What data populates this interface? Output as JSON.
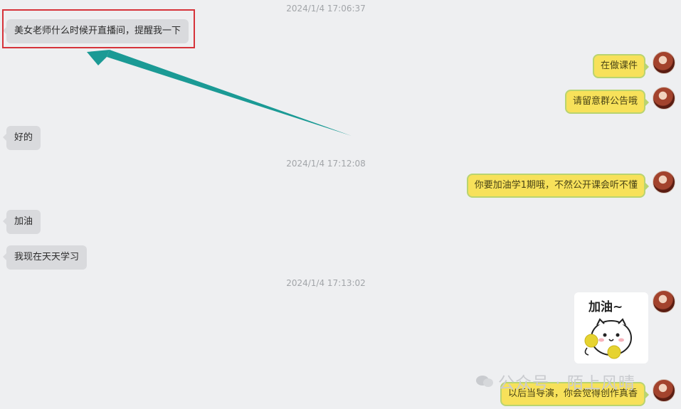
{
  "messages": [
    {
      "type": "timestamp",
      "text": "2024/1/4 17:06:37"
    },
    {
      "type": "left",
      "text": "美女老师什么时候开直播间，提醒我一下"
    },
    {
      "type": "right",
      "text": "在做课件"
    },
    {
      "type": "right",
      "text": "请留意群公告哦"
    },
    {
      "type": "left",
      "text": "好的"
    },
    {
      "type": "timestamp",
      "text": "2024/1/4 17:12:08"
    },
    {
      "type": "right",
      "text": "你要加油学1期哦，不然公开课会听不懂"
    },
    {
      "type": "left",
      "text": "加油"
    },
    {
      "type": "left",
      "text": "我现在天天学习"
    },
    {
      "type": "timestamp",
      "text": "2024/1/4 17:13:02"
    },
    {
      "type": "right",
      "text": "以后当导演，你会觉得创作真香"
    }
  ],
  "sticker": {
    "caption": "加油~"
  },
  "watermark": {
    "text": "公众号 · 陌上风晴"
  },
  "colors": {
    "highlight": "#d6333a",
    "arrow": "#1b9a95",
    "right_bubble": "#f7e15a",
    "left_bubble": "#d9dadd"
  }
}
